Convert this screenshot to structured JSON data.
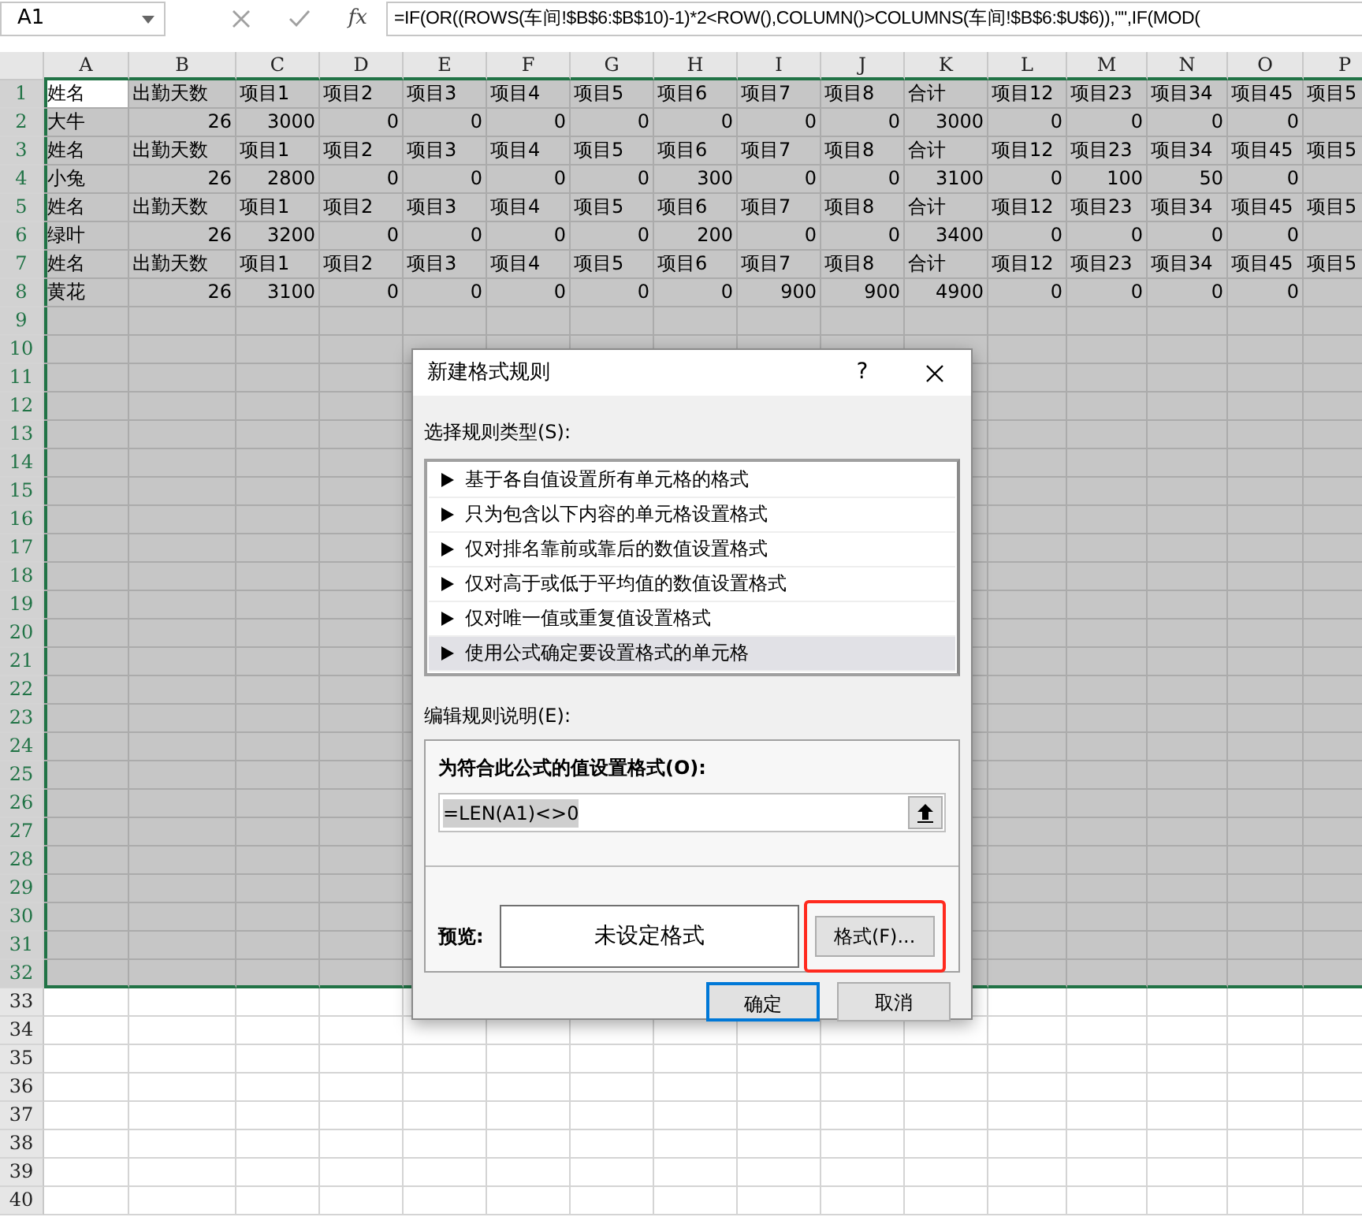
{
  "name_box": "A1",
  "formula_bar": {
    "fx_label": "fx",
    "formula": "=IF(OR((ROWS(车间!$B$6:$B$10)-1)*2<ROW(),COLUMN()>COLUMNS(车间!$B$6:$U$6)),\"\",IF(MOD("
  },
  "columns": [
    "A",
    "B",
    "C",
    "D",
    "E",
    "F",
    "G",
    "H",
    "I",
    "J",
    "K",
    "L",
    "M",
    "N",
    "O",
    "P"
  ],
  "rows": [
    {
      "number": "1",
      "selected": true,
      "active": true,
      "kind": "labels",
      "cells": [
        "姓名",
        "出勤天数",
        "项目1",
        "项目2",
        "项目3",
        "项目4",
        "项目5",
        "项目6",
        "项目7",
        "项目8",
        "合计",
        "项目12",
        "项目23",
        "项目34",
        "项目45",
        "项目5"
      ]
    },
    {
      "number": "2",
      "selected": true,
      "active": false,
      "kind": "numbers",
      "cells": [
        "大牛",
        "26",
        "3000",
        "0",
        "0",
        "0",
        "0",
        "0",
        "0",
        "0",
        "3000",
        "0",
        "0",
        "0",
        "0"
      ]
    },
    {
      "number": "3",
      "selected": true,
      "active": false,
      "kind": "labels",
      "cells": [
        "姓名",
        "出勤天数",
        "项目1",
        "项目2",
        "项目3",
        "项目4",
        "项目5",
        "项目6",
        "项目7",
        "项目8",
        "合计",
        "项目12",
        "项目23",
        "项目34",
        "项目45",
        "项目5"
      ]
    },
    {
      "number": "4",
      "selected": true,
      "active": false,
      "kind": "numbers",
      "cells": [
        "小兔",
        "26",
        "2800",
        "0",
        "0",
        "0",
        "0",
        "300",
        "0",
        "0",
        "3100",
        "0",
        "100",
        "50",
        "0"
      ]
    },
    {
      "number": "5",
      "selected": true,
      "active": false,
      "kind": "labels",
      "cells": [
        "姓名",
        "出勤天数",
        "项目1",
        "项目2",
        "项目3",
        "项目4",
        "项目5",
        "项目6",
        "项目7",
        "项目8",
        "合计",
        "项目12",
        "项目23",
        "项目34",
        "项目45",
        "项目5"
      ]
    },
    {
      "number": "6",
      "selected": true,
      "active": false,
      "kind": "numbers",
      "cells": [
        "绿叶",
        "26",
        "3200",
        "0",
        "0",
        "0",
        "0",
        "200",
        "0",
        "0",
        "3400",
        "0",
        "0",
        "0",
        "0"
      ]
    },
    {
      "number": "7",
      "selected": true,
      "active": false,
      "kind": "labels",
      "cells": [
        "姓名",
        "出勤天数",
        "项目1",
        "项目2",
        "项目3",
        "项目4",
        "项目5",
        "项目6",
        "项目7",
        "项目8",
        "合计",
        "项目12",
        "项目23",
        "项目34",
        "项目45",
        "项目5"
      ]
    },
    {
      "number": "8",
      "selected": true,
      "active": false,
      "kind": "numbers",
      "cells": [
        "黄花",
        "26",
        "3100",
        "0",
        "0",
        "0",
        "0",
        "0",
        "900",
        "900",
        "4900",
        "0",
        "0",
        "0",
        "0"
      ]
    },
    {
      "number": "9",
      "selected": true,
      "active": false
    },
    {
      "number": "10",
      "selected": true,
      "active": false
    },
    {
      "number": "11",
      "selected": true,
      "active": false
    },
    {
      "number": "12",
      "selected": true,
      "active": false
    },
    {
      "number": "13",
      "selected": true,
      "active": false
    },
    {
      "number": "14",
      "selected": true,
      "active": false
    },
    {
      "number": "15",
      "selected": true,
      "active": false
    },
    {
      "number": "16",
      "selected": true,
      "active": false
    },
    {
      "number": "17",
      "selected": true,
      "active": false
    },
    {
      "number": "18",
      "selected": true,
      "active": false
    },
    {
      "number": "19",
      "selected": true,
      "active": false
    },
    {
      "number": "20",
      "selected": true,
      "active": false
    },
    {
      "number": "21",
      "selected": true,
      "active": false
    },
    {
      "number": "22",
      "selected": true,
      "active": false
    },
    {
      "number": "23",
      "selected": true,
      "active": false
    },
    {
      "number": "24",
      "selected": true,
      "active": false
    },
    {
      "number": "25",
      "selected": true,
      "active": false
    },
    {
      "number": "26",
      "selected": true,
      "active": false
    },
    {
      "number": "27",
      "selected": true,
      "active": false
    },
    {
      "number": "28",
      "selected": true,
      "active": false
    },
    {
      "number": "29",
      "selected": true,
      "active": false
    },
    {
      "number": "30",
      "selected": true,
      "active": false
    },
    {
      "number": "31",
      "selected": true,
      "active": false
    },
    {
      "number": "32",
      "selected": true,
      "active": false
    },
    {
      "number": "33",
      "selected": false,
      "active": false
    },
    {
      "number": "34",
      "selected": false,
      "active": false
    },
    {
      "number": "35",
      "selected": false,
      "active": false
    },
    {
      "number": "36",
      "selected": false,
      "active": false
    },
    {
      "number": "37",
      "selected": false,
      "active": false
    },
    {
      "number": "38",
      "selected": false,
      "active": false
    },
    {
      "number": "39",
      "selected": false,
      "active": false
    },
    {
      "number": "40",
      "selected": false,
      "active": false
    }
  ],
  "dialog": {
    "title": "新建格式规则",
    "help": "?",
    "rule_type_label": "选择规则类型(S):",
    "rule_types": [
      {
        "label": "基于各自值设置所有单元格的格式",
        "selected": false
      },
      {
        "label": "只为包含以下内容的单元格设置格式",
        "selected": false
      },
      {
        "label": "仅对排名靠前或靠后的数值设置格式",
        "selected": false
      },
      {
        "label": "仅对高于或低于平均值的数值设置格式",
        "selected": false
      },
      {
        "label": "仅对唯一值或重复值设置格式",
        "selected": false
      },
      {
        "label": "使用公式确定要设置格式的单元格",
        "selected": true
      }
    ],
    "description_label": "编辑规则说明(E):",
    "formula_label": "为符合此公式的值设置格式(O):",
    "formula_value": "=LEN(A1)<>0",
    "preview_label": "预览:",
    "preview_text": "未设定格式",
    "format_button": {
      "label": "格式(F)...",
      "highlighted": true
    },
    "buttons": [
      {
        "label": "确定",
        "default": true
      },
      {
        "label": "取消",
        "default": false
      }
    ]
  }
}
